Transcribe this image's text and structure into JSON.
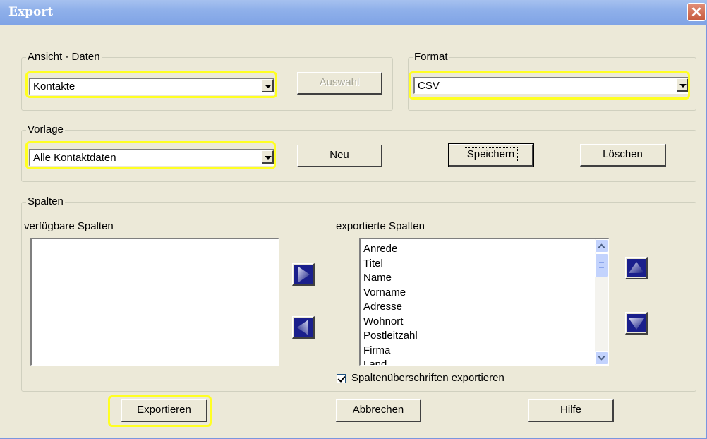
{
  "window": {
    "title": "Export",
    "close_symbol": "✕"
  },
  "ansicht": {
    "group_label": "Ansicht - Daten",
    "selected": "Kontakte",
    "auswahl_label": "Auswahl"
  },
  "format": {
    "group_label": "Format",
    "selected": "CSV"
  },
  "vorlage": {
    "group_label": "Vorlage",
    "selected": "Alle Kontaktdaten",
    "neu_label": "Neu",
    "speichern_label": "Speichern",
    "loeschen_label": "Löschen"
  },
  "spalten": {
    "group_label": "Spalten",
    "available_label": "verfügbare Spalten",
    "available_items": [],
    "exported_label": "exportierte Spalten",
    "exported_items": [
      "Anrede",
      "Titel",
      "Name",
      "Vorname",
      "Adresse",
      "Wohnort",
      "Postleitzahl",
      "Firma",
      "Land"
    ],
    "headers_checkbox_label": "Spaltenüberschriften exportieren",
    "headers_checked": true
  },
  "footer": {
    "exportieren_label": "Exportieren",
    "abbrechen_label": "Abbrechen",
    "hilfe_label": "Hilfe"
  },
  "colors": {
    "highlight": "#ffff22",
    "titlebar": "#8fb0ea",
    "dialog_bg": "#ece9d8",
    "arrow_fill": "#1a1f8c"
  }
}
